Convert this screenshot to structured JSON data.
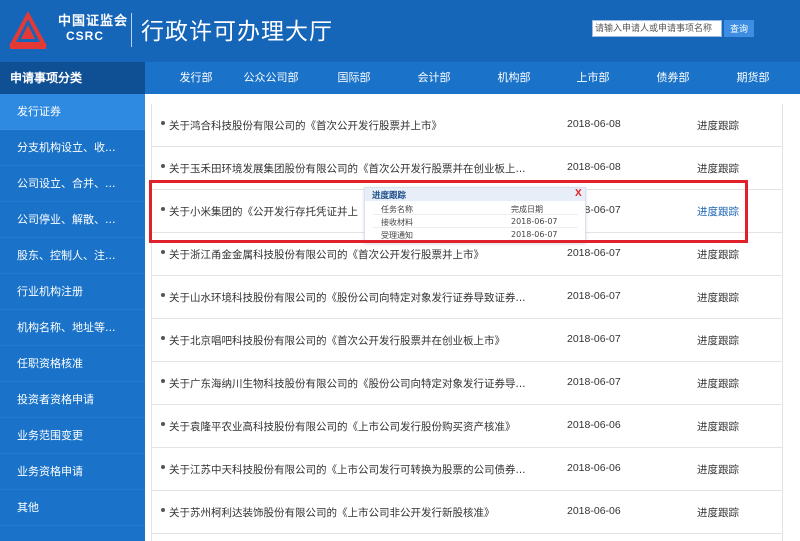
{
  "header": {
    "logo_cn": "中国证监会",
    "logo_en": "CSRC",
    "title": "行政许可办理大厅",
    "search_placeholder": "请输入申请人或申请事项名称",
    "search_button": "查询"
  },
  "sidebar": {
    "title": "申请事项分类",
    "items": [
      {
        "label": "发行证券"
      },
      {
        "label": "分支机构设立、收..."
      },
      {
        "label": "公司设立、合并、..."
      },
      {
        "label": "公司停业、解散、..."
      },
      {
        "label": "股东、控制人、注..."
      },
      {
        "label": "行业机构注册"
      },
      {
        "label": "机构名称、地址等..."
      },
      {
        "label": "任职资格核准"
      },
      {
        "label": "投资者资格申请"
      },
      {
        "label": "业务范围变更"
      },
      {
        "label": "业务资格申请"
      },
      {
        "label": "其他"
      }
    ]
  },
  "tabs": [
    {
      "label": "发行部"
    },
    {
      "label": "公众公司部"
    },
    {
      "label": "国际部"
    },
    {
      "label": "会计部"
    },
    {
      "label": "机构部"
    },
    {
      "label": "上市部"
    },
    {
      "label": "债券部"
    },
    {
      "label": "期货部"
    }
  ],
  "rows": [
    {
      "title": "关于鸿合科技股份有限公司的《首次公开发行股票并上市》",
      "date": "2018-06-08",
      "action": "进度跟踪"
    },
    {
      "title": "关于玉禾田环境发展集团股份有限公司的《首次公开发行股票并在创业板上...",
      "date": "2018-06-08",
      "action": "进度跟踪"
    },
    {
      "title": "关于小米集团的《公开发行存托凭证并上",
      "date": "2018-06-07",
      "action": "进度跟踪"
    },
    {
      "title": "关于浙江甬金金属科技股份有限公司的《首次公开发行股票并上市》",
      "date": "2018-06-07",
      "action": "进度跟踪"
    },
    {
      "title": "关于山水环境科技股份有限公司的《股份公司向特定对象发行证券导致证券...",
      "date": "2018-06-07",
      "action": "进度跟踪"
    },
    {
      "title": "关于北京唱吧科技股份有限公司的《首次公开发行股票并在创业板上市》",
      "date": "2018-06-07",
      "action": "进度跟踪"
    },
    {
      "title": "关于广东海纳川生物科技股份有限公司的《股份公司向特定对象发行证券导...",
      "date": "2018-06-07",
      "action": "进度跟踪"
    },
    {
      "title": "关于袁隆平农业高科技股份有限公司的《上市公司发行股份购买资产核准》",
      "date": "2018-06-06",
      "action": "进度跟踪"
    },
    {
      "title": "关于江苏中天科技股份有限公司的《上市公司发行可转换为股票的公司债券...",
      "date": "2018-06-06",
      "action": "进度跟踪"
    },
    {
      "title": "关于苏州柯利达装饰股份有限公司的《上市公司非公开发行新股核准》",
      "date": "2018-06-06",
      "action": "进度跟踪"
    }
  ],
  "popup": {
    "title": "进度跟踪",
    "close": "X",
    "col_task": "任务名称",
    "col_date": "完成日期",
    "items": [
      {
        "task": "接收材料",
        "date": "2018-06-07"
      },
      {
        "task": "受理通知",
        "date": "2018-06-07"
      }
    ]
  },
  "colors": {
    "header_bg": "#1565b8",
    "sidebar_bg": "#1a73c9",
    "sidebar_title_bg": "#0f4f93",
    "sidebar_active_bg": "#2d8ae0",
    "annotation_red": "#e0202a",
    "link_blue": "#1a63b3"
  }
}
